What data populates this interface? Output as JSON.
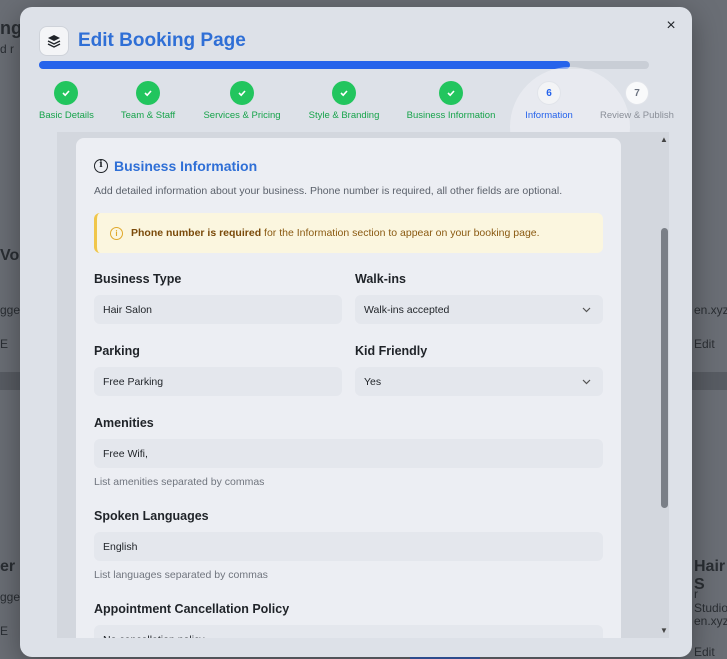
{
  "background": {
    "fragments": [
      {
        "text": "ng",
        "bold": true
      },
      {
        "text": "d r",
        "bold": false
      },
      {
        "text": "Vob",
        "bold": true
      },
      {
        "text": "gge",
        "bold": false
      },
      {
        "text": "E",
        "bold": false
      },
      {
        "text": "er",
        "bold": true
      },
      {
        "text": "gge",
        "bold": false
      },
      {
        "text": "E",
        "bold": false
      },
      {
        "text": "en.xyz/",
        "bold": false
      },
      {
        "text": "Edit",
        "bold": false
      },
      {
        "text": "Hair S",
        "bold": true
      },
      {
        "text": "r Studio",
        "bold": false
      },
      {
        "text": "en.xyz/",
        "bold": false
      },
      {
        "text": "Edit",
        "bold": false
      }
    ]
  },
  "modal": {
    "title": "Edit Booking Page",
    "close_label": "×",
    "progress_fraction": 0.87,
    "steps": [
      {
        "label": "Basic Details",
        "status": "done"
      },
      {
        "label": "Team & Staff",
        "status": "done"
      },
      {
        "label": "Services & Pricing",
        "status": "done"
      },
      {
        "label": "Style & Branding",
        "status": "done"
      },
      {
        "label": "Business Information",
        "status": "done"
      },
      {
        "label": "Information",
        "number": "6",
        "status": "current"
      },
      {
        "label": "Review & Publish",
        "number": "7",
        "status": "future"
      }
    ],
    "section": {
      "title": "Business Information",
      "description": "Add detailed information about your business. Phone number is required, all other fields are optional.",
      "notice_bold": "Phone number is required",
      "notice_rest": " for the Information section to appear on your booking page."
    },
    "fields": {
      "business_type": {
        "label": "Business Type",
        "value": "Hair Salon"
      },
      "walk_ins": {
        "label": "Walk-ins",
        "value": "Walk-ins accepted"
      },
      "parking": {
        "label": "Parking",
        "value": "Free Parking"
      },
      "kid_friendly": {
        "label": "Kid Friendly",
        "value": "Yes"
      },
      "amenities": {
        "label": "Amenities",
        "value": "Free Wifi,",
        "helper": "List amenities separated by commas"
      },
      "spoken_languages": {
        "label": "Spoken Languages",
        "value": "English",
        "helper": "List languages separated by commas"
      },
      "cancellation_policy": {
        "label": "Appointment Cancellation Policy",
        "value": "No cancellation policy"
      }
    }
  },
  "icons": {
    "logo": "layers-icon",
    "close": "close-icon",
    "check": "check-icon",
    "info": "info-icon",
    "warning": "warning-icon",
    "chevron": "chevron-down-icon"
  },
  "colors": {
    "accent": "#2563eb",
    "success": "#22c55e",
    "notice_bg": "#fbf6df",
    "notice_border": "#f0c64a"
  }
}
